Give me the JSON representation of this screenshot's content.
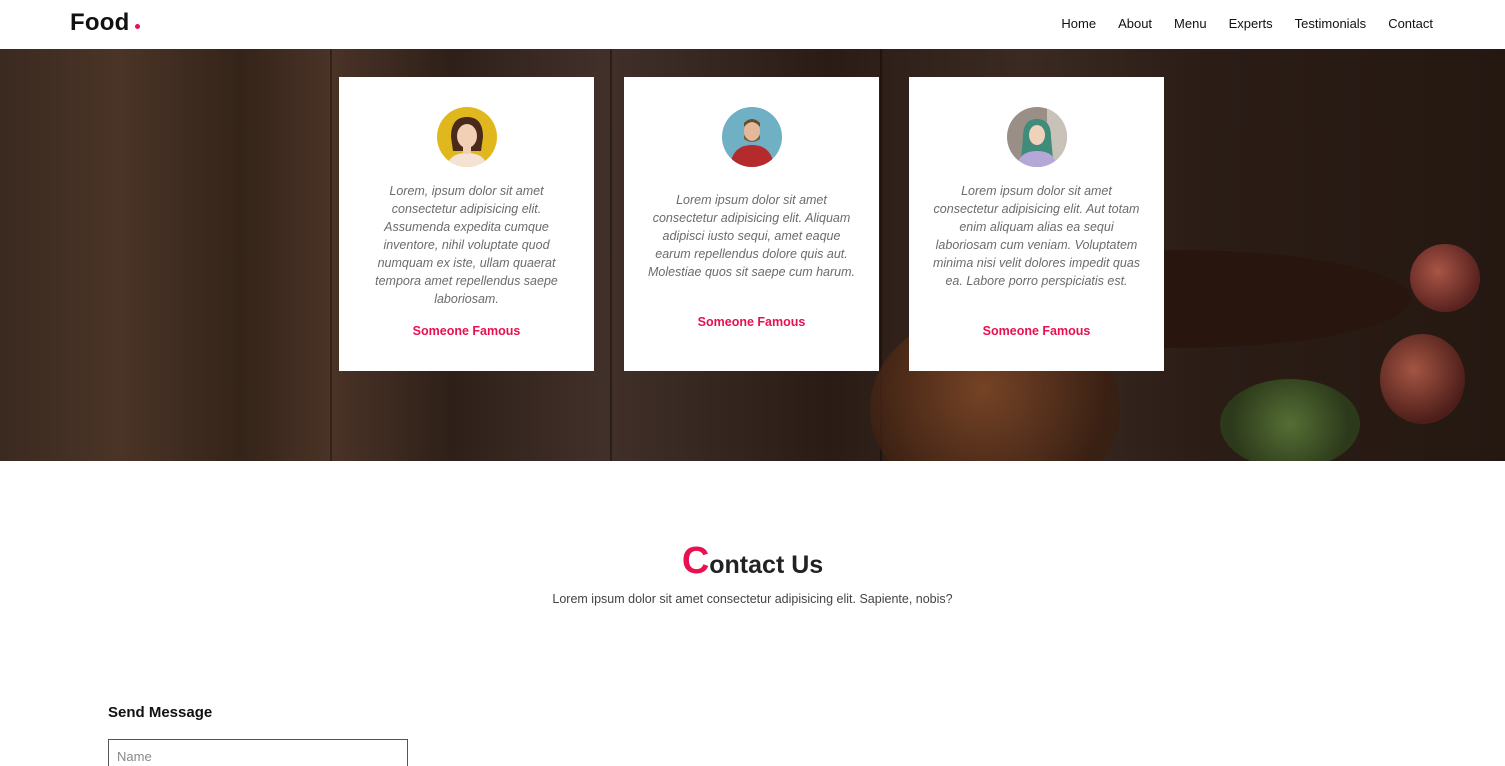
{
  "brand": {
    "name": "Food"
  },
  "nav": {
    "items": [
      "Home",
      "About",
      "Menu",
      "Experts",
      "Testimonials",
      "Contact"
    ]
  },
  "testimonials": [
    {
      "quote": "Lorem, ipsum dolor sit amet consectetur adipisicing elit. Assumenda expedita cumque inventore, nihil voluptate quod numquam ex iste, ullam quaerat tempora amet repellendus saepe laboriosam.",
      "author": "Someone Famous",
      "avatar": "woman-yellow-background-avatar"
    },
    {
      "quote": "Lorem ipsum dolor sit amet consectetur adipisicing elit. Aliquam adipisci iusto sequi, amet eaque earum repellendus dolore quis aut. Molestiae quos sit saepe cum harum.",
      "author": "Someone Famous",
      "avatar": "man-red-sweater-avatar"
    },
    {
      "quote": "Lorem ipsum dolor sit amet consectetur adipisicing elit. Aut totam enim aliquam alias ea sequi laboriosam cum veniam. Voluptatem minima nisi velit dolores impedit quas ea. Labore porro perspiciatis est.",
      "author": "Someone Famous",
      "avatar": "woman-green-hair-avatar"
    }
  ],
  "contact": {
    "title_first": "C",
    "title_rest": "ontact Us",
    "subtitle": "Lorem ipsum dolor sit amet consectetur adipisicing elit. Sapiente, nobis?",
    "form_title": "Send Message",
    "name_placeholder": "Name"
  },
  "colors": {
    "accent": "#e8114f",
    "text": "#111111",
    "quote": "#6b6b6b"
  }
}
